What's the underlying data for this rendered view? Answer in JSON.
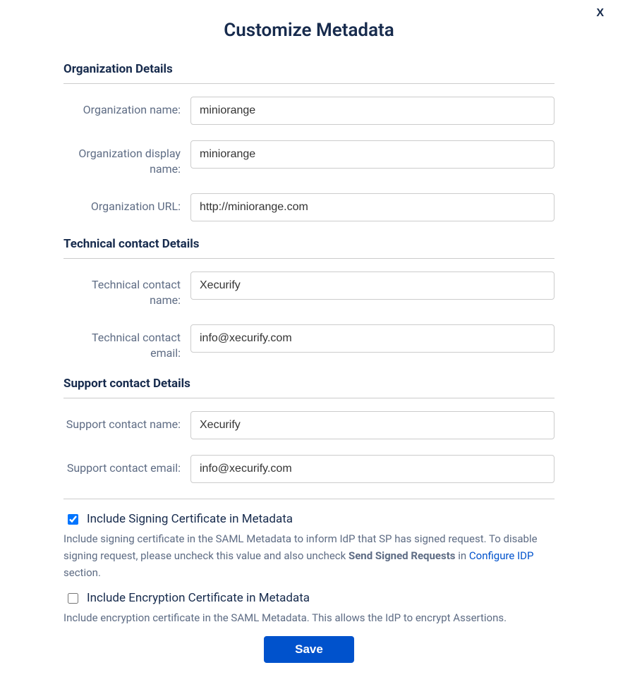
{
  "modal": {
    "close_label": "X",
    "title": "Customize Metadata"
  },
  "sections": {
    "org": {
      "header": "Organization Details",
      "name_label": "Organization name:",
      "name_value": "miniorange",
      "display_label": "Organization display name:",
      "display_value": "miniorange",
      "url_label": "Organization URL:",
      "url_value": "http://miniorange.com"
    },
    "tech": {
      "header": "Technical contact Details",
      "name_label": "Technical contact name:",
      "name_value": "Xecurify",
      "email_label": "Technical contact email:",
      "email_value": "info@xecurify.com"
    },
    "support": {
      "header": "Support contact Details",
      "name_label": "Support contact name:",
      "name_value": "Xecurify",
      "email_label": "Support contact email:",
      "email_value": "info@xecurify.com"
    }
  },
  "options": {
    "signing_label": "Include Signing Certificate in Metadata",
    "signing_help_pre": "Include signing certificate in the SAML Metadata to inform IdP that SP has signed request. To disable signing request, please uncheck this value and also uncheck ",
    "signing_help_bold": "Send Signed Requests",
    "signing_help_mid": " in ",
    "signing_help_link": "Configure IDP",
    "signing_help_post": " section.",
    "encryption_label": "Include Encryption Certificate in Metadata",
    "encryption_help": "Include encryption certificate in the SAML Metadata. This allows the IdP to encrypt Assertions."
  },
  "actions": {
    "save_label": "Save"
  }
}
